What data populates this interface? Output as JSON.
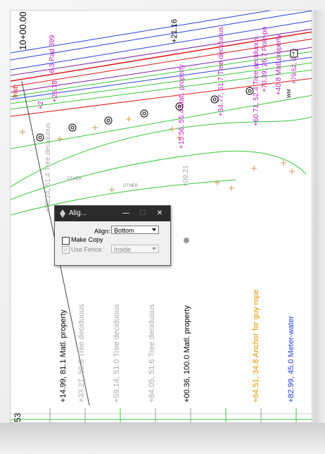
{
  "dialog": {
    "title": "Alig...",
    "align_label": "Align:",
    "align_value": "Bottom",
    "make_copy_label": "Make Copy",
    "make_copy_checked": false,
    "use_fence_label": "Use Fence:",
    "use_fence_checked": true,
    "fence_mode_value": "Inside",
    "minimize_glyph": "—",
    "maximize_glyph": "☐",
    "close_glyph": "✕"
  },
  "aligned_labels": [
    {
      "text": "+14.99,  81.1  Matl. property",
      "color": "#000000"
    },
    {
      "text": "+33.27,  50.8  Tree deciduous",
      "color": "#a8a8a8"
    },
    {
      "text": "+59.14,  51.0  Tree deciduous",
      "color": "#a8a8a8"
    },
    {
      "text": "+84.05,  51.6  Tree deciduous",
      "color": "#a8a8a8"
    },
    {
      "text": "+00.36,  100.0  Matl. property",
      "color": "#000000"
    },
    {
      "text": "+64.51,  34.8  Anchor for guy rope",
      "color": "#e69500"
    },
    {
      "text": "+82.99,  45.0  Meter-water",
      "color": "#1e3cd2"
    }
  ],
  "bottom_left_text": "53",
  "drawing_labels": {
    "station_main": "10+00.00",
    "station_end": "+21.16",
    "instr": "Instr",
    "pad": "-6.3 Pad 399",
    "l_26": "+26.78",
    "l_2": "+2",
    "matl_55": "+15.56, 55.4 Matl. property",
    "tree_top": "+34.77, 51.7 Tree deciduous",
    "tree_60": "+60.71, 52.4 Tree deciduous",
    "pole": "+70.39, 26.7 Pole-po",
    "matl_right": "+40.8 Matl.property",
    "dist_08": "+08.24, 51.4 Tree deciduous",
    "other_1": "OTHER",
    "other_2": "OTHER",
    "val_09": "+09.21",
    "num_79": "+79.52, 0.40",
    "wm": "WM",
    "box_label": "T"
  },
  "colors": {
    "accent_magenta": "#c020c0",
    "line_red": "#e01818",
    "line_green": "#38c838",
    "line_blue": "#2840e0",
    "line_purple": "#7a1fa0",
    "label_orange": "#e69500",
    "titlebar": "#2b2b2b"
  }
}
